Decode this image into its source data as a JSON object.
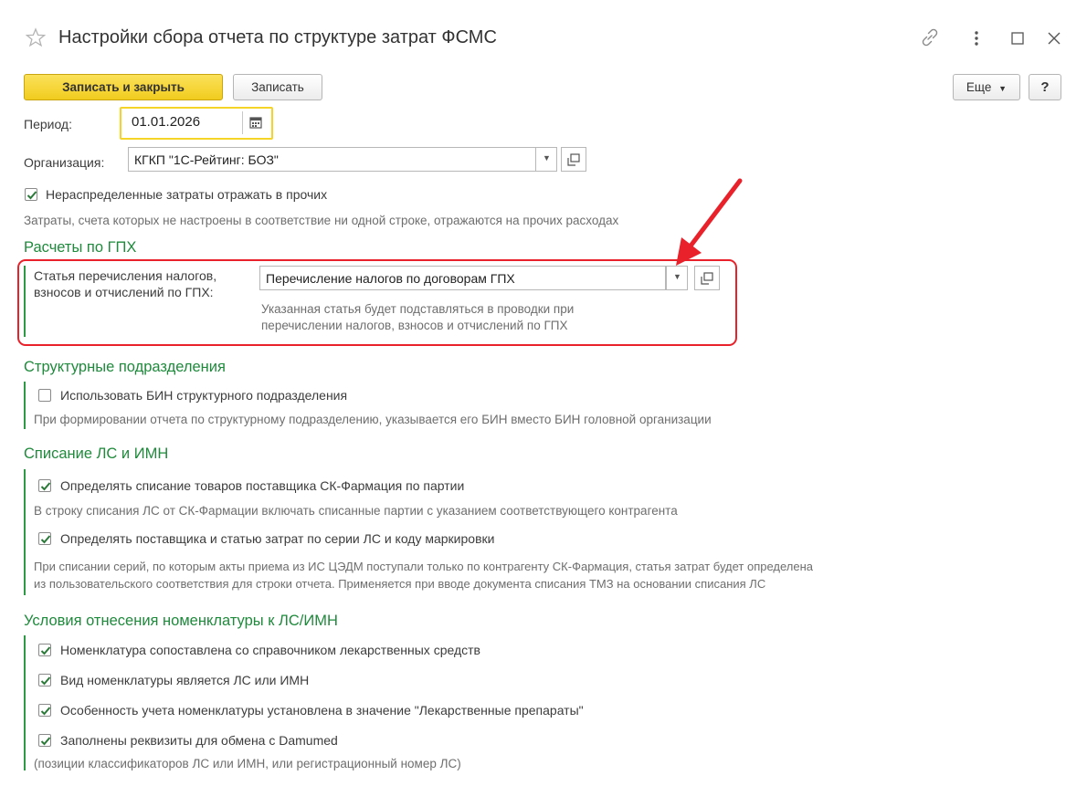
{
  "window": {
    "title": "Настройки сбора отчета по структуре затрат ФСМС"
  },
  "toolbar": {
    "save_close_label": "Записать и закрыть",
    "save_label": "Записать",
    "more_label": "Еще",
    "help_label": "?"
  },
  "period": {
    "label": "Период:",
    "value": "01.01.2026"
  },
  "organization": {
    "label": "Организация:",
    "value": "КГКП \"1С-Рейтинг: БОЗ\""
  },
  "unallocated": {
    "checked": true,
    "label": "Нераспределенные затраты отражать в прочих",
    "hint": "Затраты, счета которых не настроены в соответствие ни одной строке, отражаются на прочих расходах"
  },
  "gph": {
    "title": "Расчеты по ГПХ",
    "label_line1": "Статья перечисления налогов,",
    "label_line2": "взносов и отчислений по ГПХ:",
    "value": "Перечисление налогов по договорам ГПХ",
    "hint_line1": "Указанная статья будет подставляться в проводки при",
    "hint_line2": "перечислении налогов, взносов и отчислений по ГПХ",
    "highlight_color": "#e8212a"
  },
  "subdivisions": {
    "title": "Структурные подразделения",
    "use_bin_label": "Использовать БИН структурного подразделения",
    "use_bin_checked": false,
    "hint": "При формировании отчета по структурному подразделению, указывается его БИН вместо БИН головной организации"
  },
  "writeoff": {
    "title": "Списание ЛС и ИМН",
    "item1_label": "Определять списание товаров поставщика СК-Фармация по партии",
    "item1_checked": true,
    "item1_hint": "В строку списания ЛС от СК-Фармации включать списанные партии с указанием соответствующего контрагента",
    "item2_label": "Определять поставщика и статью затрат по серии ЛС и коду маркировки",
    "item2_checked": true,
    "item2_hint_line1": "При списании серий, по которым акты приема из ИС ЦЭДМ поступали только по контрагенту СК-Фармация, статья затрат будет определена",
    "item2_hint_line2": "из пользовательского соответствия для строки отчета. Применяется при вводе документа списания ТМЗ на основании списания ЛС"
  },
  "conditions": {
    "title": "Условия отнесения номенклатуры к ЛС/ИМН",
    "items": [
      {
        "label": "Номенклатура сопоставлена со справочником лекарственных средств",
        "checked": true
      },
      {
        "label": "Вид номенклатуры является ЛС или ИМН",
        "checked": true
      },
      {
        "label": "Особенность учета номенклатуры установлена в значение \"Лекарственные препараты\"",
        "checked": true
      },
      {
        "label": "Заполнены реквизиты для обмена с Damumed",
        "checked": true
      }
    ],
    "hint": "(позиции классификаторов ЛС или ИМН, или регистрационный номер ЛС)"
  },
  "colors": {
    "accent_yellow": "#f5d327",
    "section_green": "#1f8a3c",
    "annotation_red": "#e8212a"
  },
  "icons": {
    "favorite": "star-icon",
    "link": "link-icon",
    "menu": "more-vertical-icon",
    "maximize": "maximize-icon",
    "close": "close-icon",
    "calendar": "calendar-icon",
    "dropdown": "chevron-down-icon",
    "open": "open-form-icon",
    "annotation": "arrow-annotation"
  }
}
